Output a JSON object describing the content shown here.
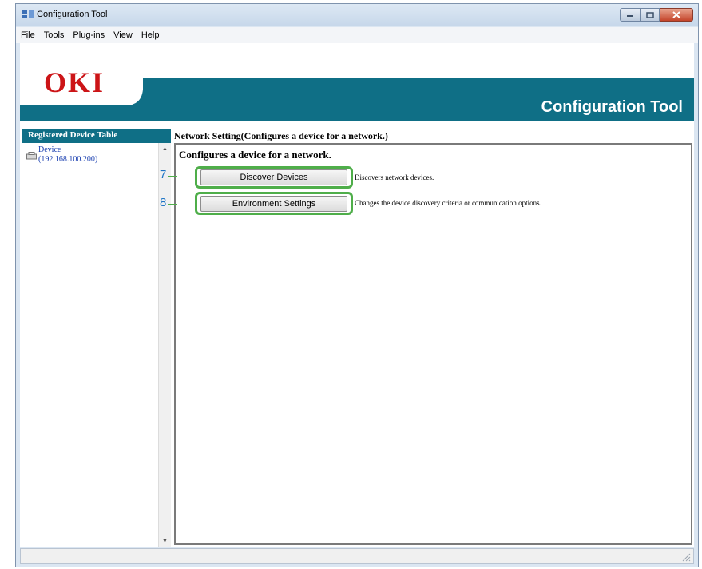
{
  "window": {
    "title": "Configuration Tool"
  },
  "menu": [
    "File",
    "Tools",
    "Plug-ins",
    "View",
    "Help"
  ],
  "banner": {
    "logo": "OKI",
    "title": "Configuration Tool"
  },
  "sidebar": {
    "header": "Registered Device Table",
    "devices": [
      {
        "name": "Device",
        "ip": "(192.168.100.200)"
      }
    ]
  },
  "main": {
    "section_title": "Network Setting(Configures a device for a network.)",
    "heading": "Configures a device for a network.",
    "actions": [
      {
        "number": "7",
        "label": "Discover Devices",
        "description": "Discovers network devices."
      },
      {
        "number": "8",
        "label": "Environment Settings",
        "description": "Changes the device discovery criteria or communication options."
      }
    ]
  },
  "colors": {
    "banner": "#0f6f86",
    "logo": "#cc1417",
    "callout_frame": "#4fae4a",
    "callout_number": "#1c74c6"
  }
}
